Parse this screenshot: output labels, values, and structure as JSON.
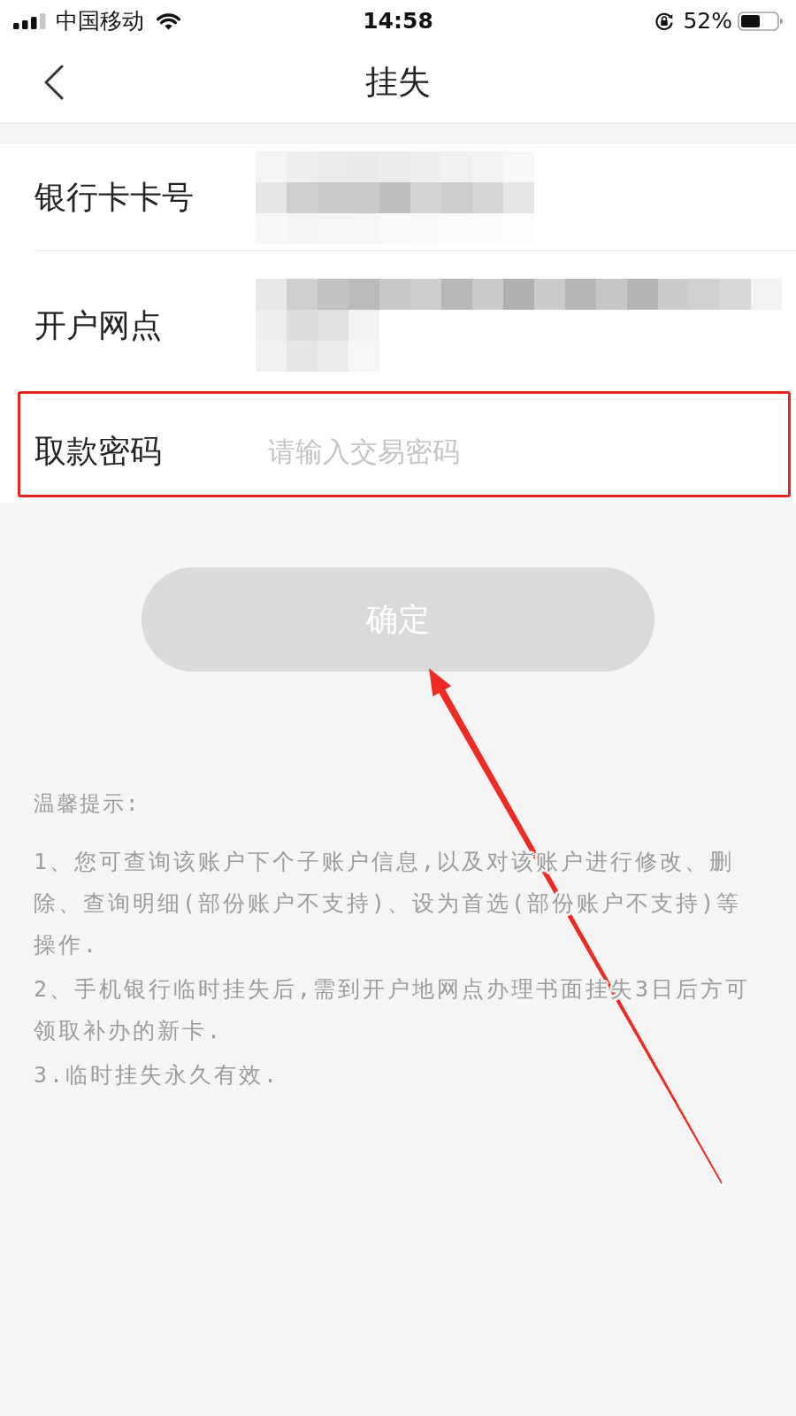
{
  "status_bar": {
    "carrier": "中国移动",
    "time": "14:58",
    "battery": "52%"
  },
  "nav_bar": {
    "title": "挂失"
  },
  "form": {
    "rows": [
      {
        "kind": "masked",
        "label": "银行卡卡号"
      },
      {
        "kind": "masked",
        "label": "开户网点"
      },
      {
        "kind": "input",
        "label": "取款密码",
        "placeholder": "请输入交易密码"
      }
    ]
  },
  "confirm_button": {
    "label": "确定",
    "disabled": true
  },
  "tips": {
    "title": "温馨提示:",
    "items": [
      "1、您可查询该账户下个子账户信息,以及对该账户进行修改、删除、查询明细(部份账户不支持)、设为首选(部份账户不支持)等操作.",
      "2、手机银行临时挂失后,需到开户地网点办理书面挂失3日后方可领取补办的新卡.",
      "3.临时挂失永久有效."
    ]
  }
}
